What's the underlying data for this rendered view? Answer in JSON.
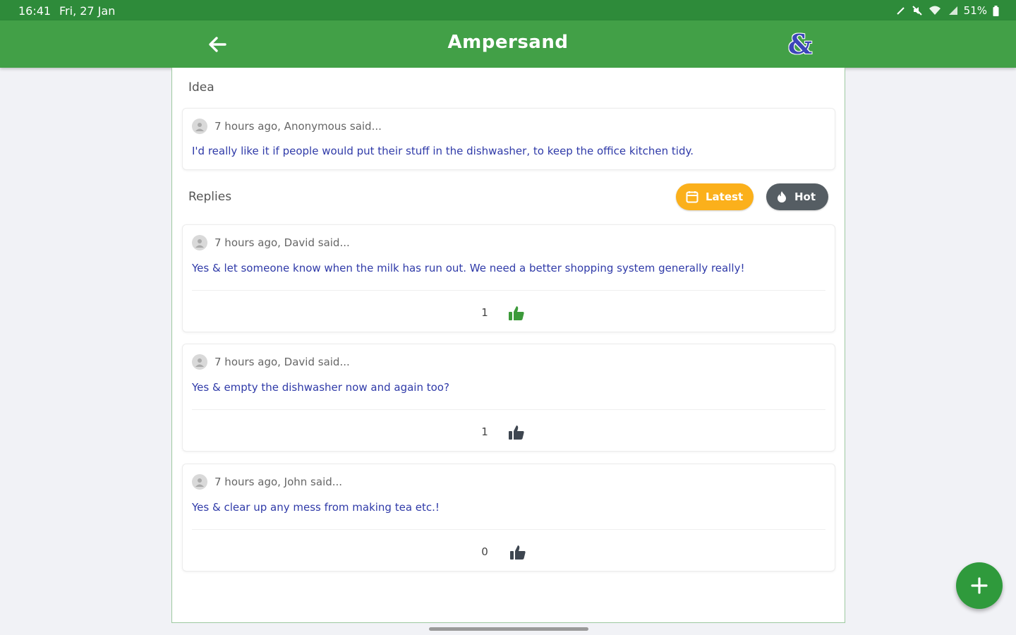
{
  "status_bar": {
    "time": "16:41",
    "date": "Fri, 27 Jan",
    "battery": "51%"
  },
  "app_bar": {
    "title": "Ampersand",
    "logo_text": "&"
  },
  "idea": {
    "section_label": "Idea",
    "meta": "7 hours ago, Anonymous said...",
    "text": "I'd really like it if people would put their stuff in the dishwasher, to keep the office kitchen tidy."
  },
  "replies": {
    "section_label": "Replies",
    "sort_latest_label": "Latest",
    "sort_hot_label": "Hot",
    "items": [
      {
        "meta": "7 hours ago, David said...",
        "text": "Yes & let someone know when the milk has run out. We need a better shopping system generally really!",
        "votes": "1",
        "liked": true
      },
      {
        "meta": "7 hours ago, David said...",
        "text": "Yes & empty the dishwasher now and again too?",
        "votes": "1",
        "liked": false
      },
      {
        "meta": "7 hours ago, John said...",
        "text": "Yes & clear up any mess from making tea etc.!",
        "votes": "0",
        "liked": false
      }
    ]
  },
  "colors": {
    "status_bar": "#2e8b3a",
    "app_bar": "#42a047",
    "latest_chip": "#fbb01b",
    "hot_chip": "#555d63",
    "liked_thumb": "#3c9a3a",
    "unliked_thumb": "#3e4650",
    "body_text": "#2f3aa8",
    "fab": "#2f9a3c"
  },
  "icons": {
    "back": "arrow-left-icon",
    "logo": "ampersand-logo",
    "latest": "calendar-icon",
    "hot": "fire-icon",
    "vote": "thumbs-up-icon",
    "fab": "plus-icon"
  }
}
